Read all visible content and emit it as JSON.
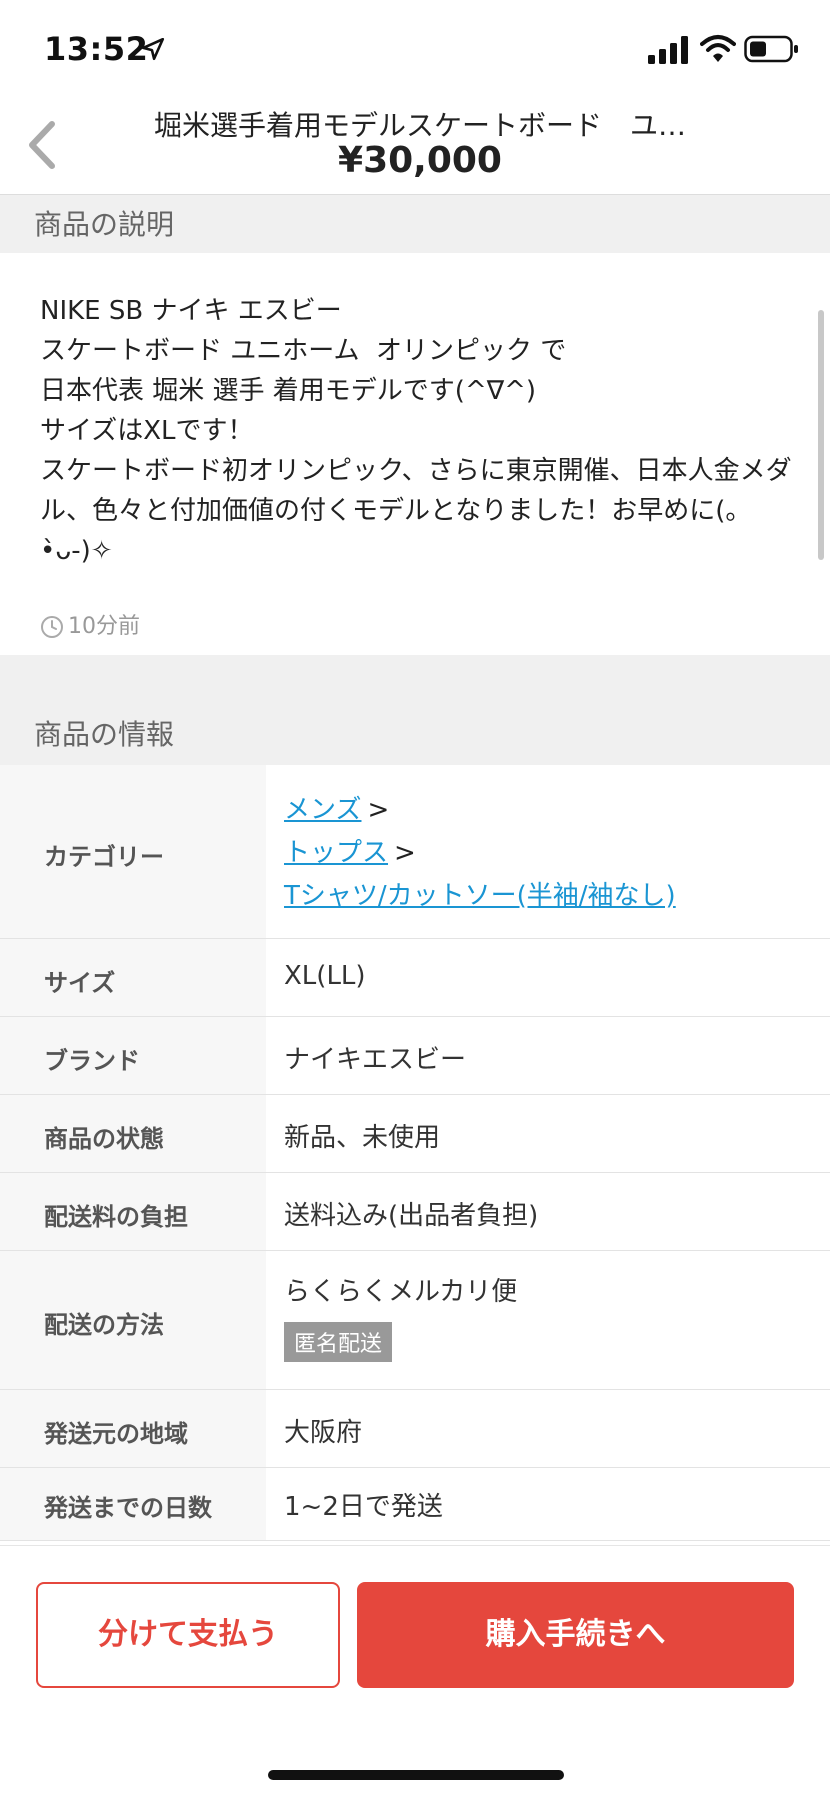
{
  "status_bar": {
    "time": "13:52",
    "icons": [
      "location-arrow-icon",
      "signal-icon",
      "wifi-icon",
      "battery-icon"
    ]
  },
  "header": {
    "title": "堀米選手着用モデルスケートボード　ユ…",
    "price": "¥30,000",
    "back_icon": "chevron-left-icon"
  },
  "description": {
    "section_title": "商品の説明",
    "text": "NIKE SB ナイキ エスビー\nスケートボード ユニホーム  オリンピック で\n日本代表 堀米 選手 着用モデルです(^∇^)\nサイズはXLです！\nスケートボード初オリンピック、さらに東京開催、日本人金メダル、色々と付加価値の付くモデルとなりました！お早めに(。•̀ᴗ-)✧",
    "posted": "10分前"
  },
  "info": {
    "section_title": "商品の情報",
    "category": {
      "label": "カテゴリー",
      "links": [
        "メンズ",
        "トップス",
        "Tシャツ/カットソー(半袖/袖なし)"
      ],
      "separator": ">"
    },
    "size": {
      "label": "サイズ",
      "value": "XL(LL)"
    },
    "brand": {
      "label": "ブランド",
      "value": "ナイキエスビー"
    },
    "condition": {
      "label": "商品の状態",
      "value": "新品、未使用"
    },
    "shipping_fee": {
      "label": "配送料の負担",
      "value": "送料込み(出品者負担)"
    },
    "shipping_method": {
      "label": "配送の方法",
      "value": "らくらくメルカリ便",
      "badge": "匿名配送"
    },
    "ship_from": {
      "label": "発送元の地域",
      "value": "大阪府"
    },
    "ship_days": {
      "label": "発送までの日数",
      "value": "1~2日で発送"
    }
  },
  "actions": {
    "split_pay": "分けて支払う",
    "purchase": "購入手続きへ"
  },
  "colors": {
    "accent_red": "#e5473d",
    "link_blue": "#1a95d3",
    "section_bg": "#f0f0f0",
    "badge_gray": "#999999"
  }
}
